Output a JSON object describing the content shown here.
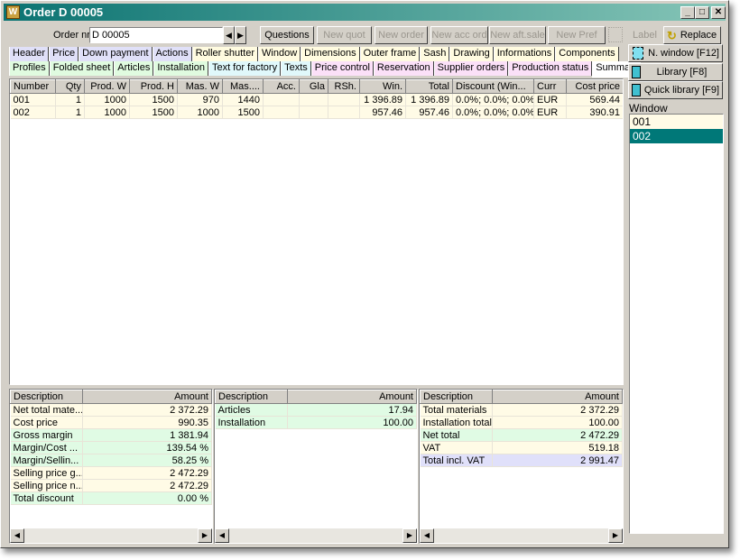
{
  "window": {
    "title": "Order D 00005",
    "app_icon": "W",
    "controls": [
      "_",
      "□",
      "✕"
    ]
  },
  "toolbar": {
    "order_label": "Order nr",
    "order_value": "D 00005",
    "buttons": [
      {
        "label": "Questions",
        "enabled": true
      },
      {
        "label": "New quot",
        "enabled": false
      },
      {
        "label": "New order",
        "enabled": false
      },
      {
        "label": "New acc ord",
        "enabled": false
      },
      {
        "label": "New aft.sale",
        "enabled": false
      },
      {
        "label": "New Pref",
        "enabled": false
      }
    ],
    "label_button": "Label",
    "replace_button": "Replace"
  },
  "tabs_row1": [
    {
      "label": "Header",
      "color": "#e0e0f8"
    },
    {
      "label": "Price",
      "color": "#e0e0f8"
    },
    {
      "label": "Down payment",
      "color": "#e0e0f8"
    },
    {
      "label": "Actions",
      "color": "#e0e0f8"
    },
    {
      "label": "Roller shutter",
      "color": "#fffbe0"
    },
    {
      "label": "Window",
      "color": "#fffbe0"
    },
    {
      "label": "Dimensions",
      "color": "#fffbe0"
    },
    {
      "label": "Outer frame",
      "color": "#fffbe0"
    },
    {
      "label": "Sash",
      "color": "#fffbe0"
    },
    {
      "label": "Drawing",
      "color": "#fffbe0"
    },
    {
      "label": "Informations",
      "color": "#fffbe0"
    },
    {
      "label": "Components",
      "color": "#fffbe0"
    }
  ],
  "tabs_row2": [
    {
      "label": "Profiles",
      "color": "#e0fbe0"
    },
    {
      "label": "Folded sheet",
      "color": "#e0fbe0"
    },
    {
      "label": "Articles",
      "color": "#e0fbe0"
    },
    {
      "label": "Installation",
      "color": "#e0fbe0"
    },
    {
      "label": "Text for factory",
      "color": "#e0f8fb"
    },
    {
      "label": "Texts",
      "color": "#e0f8fb"
    },
    {
      "label": "Price control",
      "color": "#fbe0f8"
    },
    {
      "label": "Reservation",
      "color": "#fbe0f8"
    },
    {
      "label": "Supplier orders",
      "color": "#fbe0f8"
    },
    {
      "label": "Production status",
      "color": "#fbe0f8"
    },
    {
      "label": "Summary",
      "color": "#ffffff",
      "active": true
    }
  ],
  "main_grid": {
    "columns": [
      "Number",
      "Qty",
      "Prod. W",
      "Prod. H",
      "Mas. W",
      "Mas....",
      "Acc.",
      "Gla",
      "RSh.",
      "Win.",
      "Total",
      "Discount (Win...",
      "Curr",
      "Cost price"
    ],
    "rows": [
      [
        "001",
        "1",
        "1000",
        "1500",
        "970",
        "1440",
        "",
        "",
        "",
        "1 396.89",
        "1 396.89",
        "0.0%; 0.0%; 0.0%",
        "EUR",
        "569.44"
      ],
      [
        "002",
        "1",
        "1000",
        "1500",
        "1000",
        "1500",
        "",
        "",
        "",
        "957.46",
        "957.46",
        "0.0%; 0.0%; 0.0%",
        "EUR",
        "390.91"
      ]
    ]
  },
  "side": {
    "n_window": "N. window [F12]",
    "library": "Library [F8]",
    "quick_library": "Quick library [F9]",
    "window_label": "Window",
    "windows": [
      "001",
      "002"
    ],
    "selected": "002"
  },
  "summary_grids": [
    {
      "columns": [
        "Description",
        "Amount"
      ],
      "rows": [
        {
          "d": "Net total mate...",
          "a": "2 372.29",
          "c": "y"
        },
        {
          "d": "Cost price",
          "a": "990.35",
          "c": "y"
        },
        {
          "d": "Gross margin",
          "a": "1 381.94",
          "c": "g"
        },
        {
          "d": "Margin/Cost ...",
          "a": "139.54 %",
          "c": "g"
        },
        {
          "d": "Margin/Sellin...",
          "a": "58.25 %",
          "c": "g"
        },
        {
          "d": "Selling price g...",
          "a": "2 472.29",
          "c": "y"
        },
        {
          "d": "Selling price n...",
          "a": "2 472.29",
          "c": "y"
        },
        {
          "d": "Total discount",
          "a": "0.00 %",
          "c": "g"
        }
      ]
    },
    {
      "columns": [
        "Description",
        "Amount"
      ],
      "rows": [
        {
          "d": "Articles",
          "a": "17.94",
          "c": "g"
        },
        {
          "d": "Installation",
          "a": "100.00",
          "c": "g"
        }
      ]
    },
    {
      "columns": [
        "Description",
        "Amount"
      ],
      "rows": [
        {
          "d": "Total materials",
          "a": "2 372.29",
          "c": "y"
        },
        {
          "d": "Installation total",
          "a": "100.00",
          "c": "y"
        },
        {
          "d": "Net total",
          "a": "2 472.29",
          "c": "g"
        },
        {
          "d": "VAT",
          "a": "519.18",
          "c": "y"
        },
        {
          "d": "Total incl. VAT",
          "a": "2 991.47",
          "c": "b"
        }
      ]
    }
  ]
}
